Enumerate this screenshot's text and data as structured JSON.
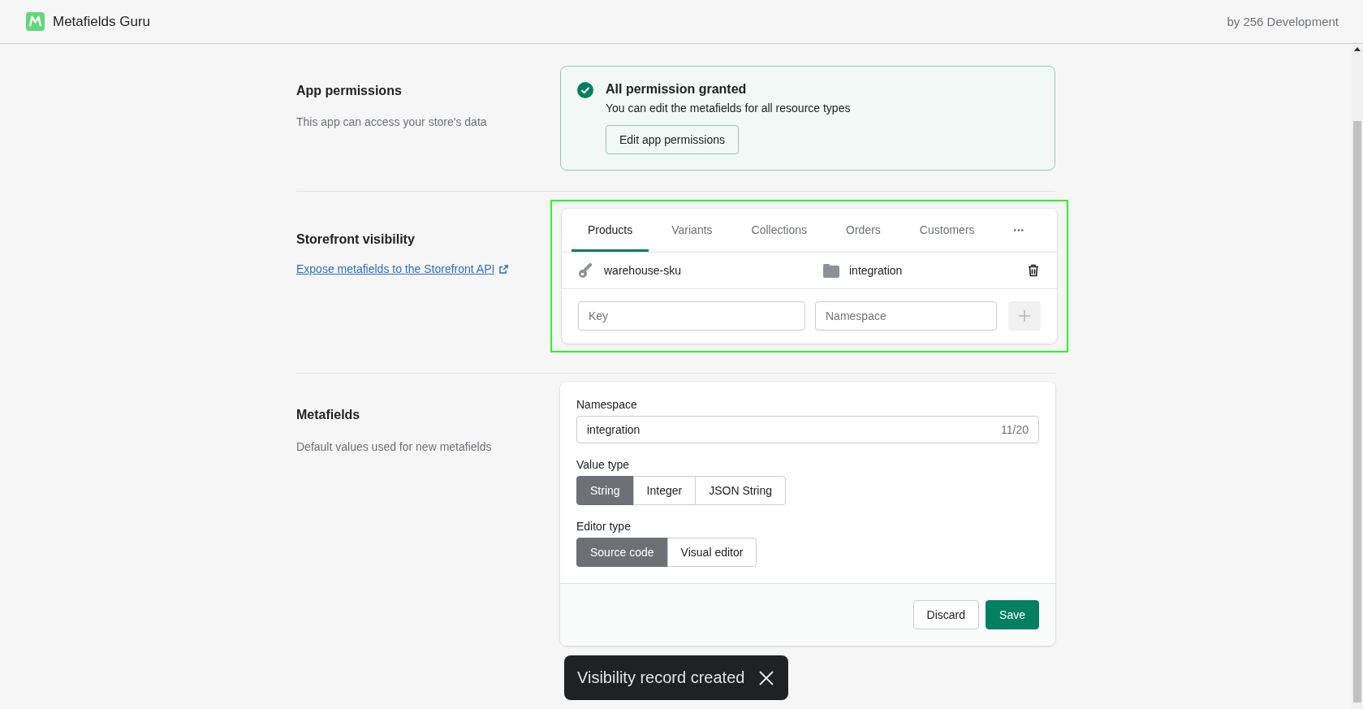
{
  "header": {
    "app_name": "Metafields Guru",
    "developer": "by 256 Development"
  },
  "permissions": {
    "title": "App permissions",
    "description": "This app can access your store's data",
    "banner_title": "All permission granted",
    "banner_text": "You can edit the metafields for all resource types",
    "button": "Edit app permissions"
  },
  "storefront": {
    "title": "Storefront visibility",
    "link": "Expose metafields to the Storefront API",
    "highlighted": true,
    "tabs": [
      {
        "label": "Products",
        "selected": true
      },
      {
        "label": "Variants",
        "selected": false
      },
      {
        "label": "Collections",
        "selected": false
      },
      {
        "label": "Orders",
        "selected": false
      },
      {
        "label": "Customers",
        "selected": false
      }
    ],
    "more": "•••",
    "records": [
      {
        "key": "warehouse-sku",
        "namespace": "integration"
      }
    ],
    "key_placeholder": "Key",
    "namespace_placeholder": "Namespace"
  },
  "metafields": {
    "title": "Metafields",
    "description": "Default values used for new metafields",
    "namespace_label": "Namespace",
    "namespace_value": "integration",
    "namespace_count": "11/20",
    "value_type_label": "Value type",
    "value_types": [
      {
        "label": "String",
        "selected": true
      },
      {
        "label": "Integer",
        "selected": false
      },
      {
        "label": "JSON String",
        "selected": false
      }
    ],
    "editor_type_label": "Editor type",
    "editor_types": [
      {
        "label": "Source code",
        "selected": true
      },
      {
        "label": "Visual editor",
        "selected": false
      }
    ],
    "discard": "Discard",
    "save": "Save"
  },
  "toast": {
    "message": "Visibility record created"
  }
}
